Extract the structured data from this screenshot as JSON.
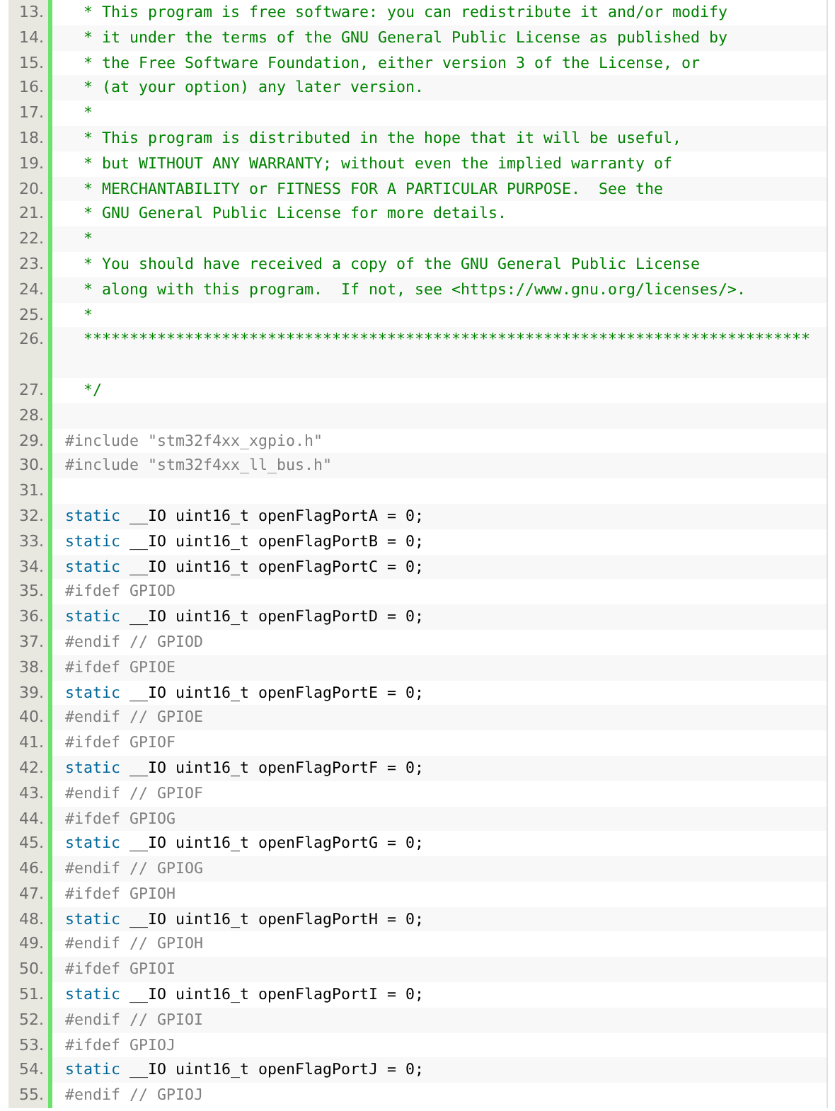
{
  "lines": [
    {
      "number": "13.",
      "tokens": [
        {
          "kind": "comment",
          "text": "  * This program is free software: you can redistribute it and/or modify"
        }
      ]
    },
    {
      "number": "14.",
      "tokens": [
        {
          "kind": "comment",
          "text": "  * it under the terms of the GNU General Public License as published by"
        }
      ]
    },
    {
      "number": "15.",
      "tokens": [
        {
          "kind": "comment",
          "text": "  * the Free Software Foundation, either version 3 of the License, or"
        }
      ]
    },
    {
      "number": "16.",
      "tokens": [
        {
          "kind": "comment",
          "text": "  * (at your option) any later version."
        }
      ]
    },
    {
      "number": "17.",
      "tokens": [
        {
          "kind": "comment",
          "text": "  *"
        }
      ]
    },
    {
      "number": "18.",
      "tokens": [
        {
          "kind": "comment",
          "text": "  * This program is distributed in the hope that it will be useful,"
        }
      ]
    },
    {
      "number": "19.",
      "tokens": [
        {
          "kind": "comment",
          "text": "  * but WITHOUT ANY WARRANTY; without even the implied warranty of"
        }
      ]
    },
    {
      "number": "20.",
      "tokens": [
        {
          "kind": "comment",
          "text": "  * MERCHANTABILITY or FITNESS FOR A PARTICULAR PURPOSE.  See the"
        }
      ]
    },
    {
      "number": "21.",
      "tokens": [
        {
          "kind": "comment",
          "text": "  * GNU General Public License for more details."
        }
      ]
    },
    {
      "number": "22.",
      "tokens": [
        {
          "kind": "comment",
          "text": "  *"
        }
      ]
    },
    {
      "number": "23.",
      "tokens": [
        {
          "kind": "comment",
          "text": "  * You should have received a copy of the GNU General Public License"
        }
      ]
    },
    {
      "number": "24.",
      "tokens": [
        {
          "kind": "comment",
          "text": "  * along with this program.  If not, see <https://www.gnu.org/licenses/>."
        }
      ]
    },
    {
      "number": "25.",
      "tokens": [
        {
          "kind": "comment",
          "text": "  *"
        }
      ]
    },
    {
      "number": "26.",
      "wrapped": true,
      "tokens": [
        {
          "kind": "comment",
          "text": "  *******************************************************************************"
        }
      ]
    },
    {
      "number": "27.",
      "tokens": [
        {
          "kind": "comment",
          "text": "  */"
        }
      ]
    },
    {
      "number": "28."
    },
    {
      "number": "29.",
      "tokens": [
        {
          "kind": "preprocessor",
          "text": "#include \"stm32f4xx_xgpio.h\""
        }
      ]
    },
    {
      "number": "30.",
      "tokens": [
        {
          "kind": "preprocessor",
          "text": "#include \"stm32f4xx_ll_bus.h\""
        }
      ]
    },
    {
      "number": "31."
    },
    {
      "number": "32.",
      "tokens": [
        {
          "kind": "keyword",
          "text": "static"
        },
        {
          "kind": "plain",
          "text": " __IO uint16_t openFlagPortA = 0;"
        }
      ]
    },
    {
      "number": "33.",
      "tokens": [
        {
          "kind": "keyword",
          "text": "static"
        },
        {
          "kind": "plain",
          "text": " __IO uint16_t openFlagPortB = 0;"
        }
      ]
    },
    {
      "number": "34.",
      "tokens": [
        {
          "kind": "keyword",
          "text": "static"
        },
        {
          "kind": "plain",
          "text": " __IO uint16_t openFlagPortC = 0;"
        }
      ]
    },
    {
      "number": "35.",
      "tokens": [
        {
          "kind": "preprocessor",
          "text": "#ifdef GPIOD"
        }
      ]
    },
    {
      "number": "36.",
      "tokens": [
        {
          "kind": "keyword",
          "text": "static"
        },
        {
          "kind": "plain",
          "text": " __IO uint16_t openFlagPortD = 0;"
        }
      ]
    },
    {
      "number": "37.",
      "tokens": [
        {
          "kind": "preprocessor",
          "text": "#endif // GPIOD"
        }
      ]
    },
    {
      "number": "38.",
      "tokens": [
        {
          "kind": "preprocessor",
          "text": "#ifdef GPIOE"
        }
      ]
    },
    {
      "number": "39.",
      "tokens": [
        {
          "kind": "keyword",
          "text": "static"
        },
        {
          "kind": "plain",
          "text": " __IO uint16_t openFlagPortE = 0;"
        }
      ]
    },
    {
      "number": "40.",
      "tokens": [
        {
          "kind": "preprocessor",
          "text": "#endif // GPIOE"
        }
      ]
    },
    {
      "number": "41.",
      "tokens": [
        {
          "kind": "preprocessor",
          "text": "#ifdef GPIOF"
        }
      ]
    },
    {
      "number": "42.",
      "tokens": [
        {
          "kind": "keyword",
          "text": "static"
        },
        {
          "kind": "plain",
          "text": " __IO uint16_t openFlagPortF = 0;"
        }
      ]
    },
    {
      "number": "43.",
      "tokens": [
        {
          "kind": "preprocessor",
          "text": "#endif // GPIOF"
        }
      ]
    },
    {
      "number": "44.",
      "tokens": [
        {
          "kind": "preprocessor",
          "text": "#ifdef GPIOG"
        }
      ]
    },
    {
      "number": "45.",
      "tokens": [
        {
          "kind": "keyword",
          "text": "static"
        },
        {
          "kind": "plain",
          "text": " __IO uint16_t openFlagPortG = 0;"
        }
      ]
    },
    {
      "number": "46.",
      "tokens": [
        {
          "kind": "preprocessor",
          "text": "#endif // GPIOG"
        }
      ]
    },
    {
      "number": "47.",
      "tokens": [
        {
          "kind": "preprocessor",
          "text": "#ifdef GPIOH"
        }
      ]
    },
    {
      "number": "48.",
      "tokens": [
        {
          "kind": "keyword",
          "text": "static"
        },
        {
          "kind": "plain",
          "text": " __IO uint16_t openFlagPortH = 0;"
        }
      ]
    },
    {
      "number": "49.",
      "tokens": [
        {
          "kind": "preprocessor",
          "text": "#endif // GPIOH"
        }
      ]
    },
    {
      "number": "50.",
      "tokens": [
        {
          "kind": "preprocessor",
          "text": "#ifdef GPIOI"
        }
      ]
    },
    {
      "number": "51.",
      "tokens": [
        {
          "kind": "keyword",
          "text": "static"
        },
        {
          "kind": "plain",
          "text": " __IO uint16_t openFlagPortI = 0;"
        }
      ]
    },
    {
      "number": "52.",
      "tokens": [
        {
          "kind": "preprocessor",
          "text": "#endif // GPIOI"
        }
      ]
    },
    {
      "number": "53.",
      "tokens": [
        {
          "kind": "preprocessor",
          "text": "#ifdef GPIOJ"
        }
      ]
    },
    {
      "number": "54.",
      "tokens": [
        {
          "kind": "keyword",
          "text": "static"
        },
        {
          "kind": "plain",
          "text": " __IO uint16_t openFlagPortJ = 0;"
        }
      ]
    },
    {
      "number": "55.",
      "tokens": [
        {
          "kind": "preprocessor",
          "text": "#endif // GPIOJ"
        }
      ]
    }
  ]
}
